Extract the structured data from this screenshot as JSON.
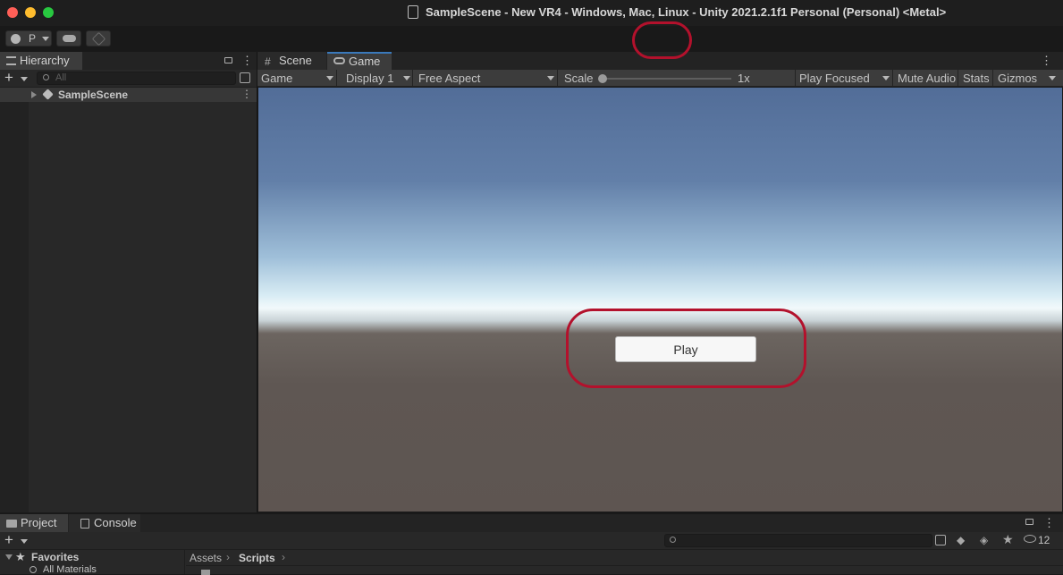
{
  "window": {
    "title": "SampleScene - New VR4 - Windows, Mac, Linux - Unity 2021.2.1f1 Personal (Personal) <Metal>"
  },
  "toolbar": {
    "account_label": "P"
  },
  "hierarchy": {
    "tab_label": "Hierarchy",
    "search_placeholder": "All",
    "scene_name": "SampleScene"
  },
  "game_view": {
    "tabs": [
      {
        "label": "Scene"
      },
      {
        "label": "Game"
      }
    ],
    "display_mode": "Game",
    "display": "Display 1",
    "aspect": "Free Aspect",
    "scale_label": "Scale",
    "scale_value": "1x",
    "play_mode": "Play Focused",
    "mute_audio": "Mute Audio",
    "stats": "Stats",
    "gizmos": "Gizmos",
    "play_button_label": "Play"
  },
  "project": {
    "tabs": [
      {
        "label": "Project"
      },
      {
        "label": "Console"
      }
    ],
    "favorites_label": "Favorites",
    "favorites_items": [
      "All Materials"
    ],
    "breadcrumb": [
      "Assets",
      "Scripts"
    ],
    "hidden_count": "12"
  },
  "colors": {
    "highlight_ring": "#b3112c",
    "play_active": "#3d5a7f"
  }
}
